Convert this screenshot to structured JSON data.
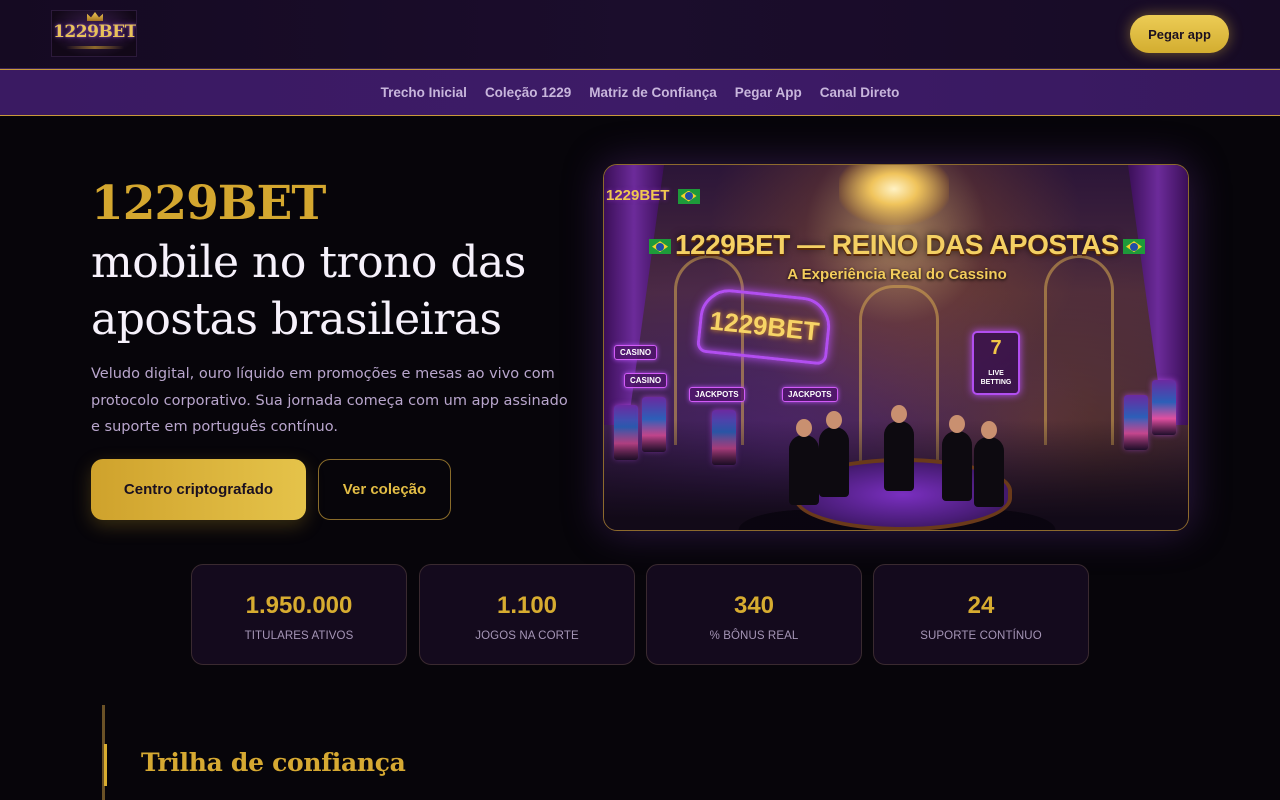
{
  "header": {
    "logo_text": "1229BET",
    "app_button": "Pegar app"
  },
  "nav": {
    "links": [
      "Trecho Inicial",
      "Coleção 1229",
      "Matriz de Confiança",
      "Pegar App",
      "Canal Direto"
    ]
  },
  "hero": {
    "brand": "1229BET",
    "title": "mobile no trono das apostas brasileiras",
    "description": "Veludo digital, ouro líquido em promoções e mesas ao vivo com protocolo corporativo. Sua jornada começa com um app assinado e suporte em português contínuo.",
    "primary_button": "Centro criptografado",
    "secondary_button": "Ver coleção"
  },
  "hero_image": {
    "mini_logo": "1229BET",
    "headline": "1229BET — REINO DAS APOSTAS",
    "subline": "A Experiência Real do Cassino",
    "neon_sign": "1229BET",
    "tag_casino": "CASINO",
    "tag_jackpots": "JACKPOTS",
    "live_seven": "7",
    "live_text": "LIVE BETTING"
  },
  "stats": [
    {
      "value": "1.950.000",
      "label": "TITULARES ATIVOS"
    },
    {
      "value": "1.100",
      "label": "JOGOS NA CORTE"
    },
    {
      "value": "340",
      "label": "% BÔNUS REAL"
    },
    {
      "value": "24",
      "label": "SUPORTE CONTÍNUO"
    }
  ],
  "section": {
    "title": "Trilha de confiança"
  },
  "colors": {
    "accent_gold": "#d4a72f",
    "nav_purple": "#3b1a64",
    "background": "#07050a"
  }
}
